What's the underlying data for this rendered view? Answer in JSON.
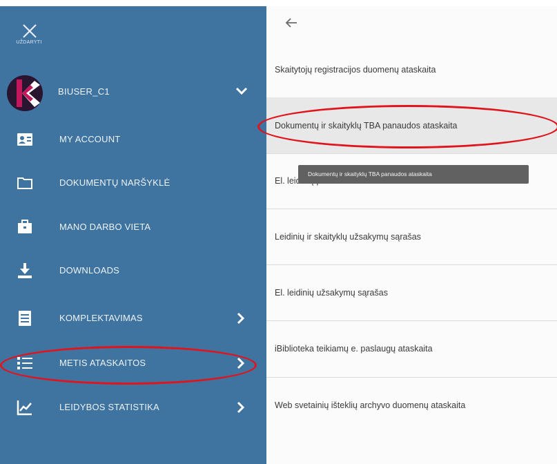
{
  "sidebar": {
    "close_caption": "UŽDARYTI",
    "user": {
      "name": "BIUSER_C1"
    },
    "items": [
      {
        "label": "MY ACCOUNT",
        "icon": "account-card-icon"
      },
      {
        "label": "DOKUMENTŲ NARŠYKLĖ",
        "icon": "folder-icon"
      },
      {
        "label": "MANO DARBO VIETA",
        "icon": "briefcase-icon"
      },
      {
        "label": "DOWNLOADS",
        "icon": "download-icon"
      },
      {
        "label": "KOMPLEKTAVIMAS",
        "icon": "document-icon"
      },
      {
        "label": "METIS ATASKAITOS",
        "icon": "list-icon"
      },
      {
        "label": "LEIDYBOS STATISTIKA",
        "icon": "chart-icon"
      }
    ]
  },
  "panel": {
    "reports": [
      "Skaitytojų registracijos duomenų ataskaita",
      "Dokumentų ir skaityklų TBA panaudos ataskaita",
      "El. leidinių panaudos ataskaita",
      "Leidinių ir skaityklų užsakymų sąrašas",
      "El. leidinių užsakymų sąrašas",
      "iBiblioteka teikiamų e. paslaugų ataskaita",
      "Web svetainių išteklių archyvo duomenų ataskaita"
    ],
    "tooltip": "Dokumentų ir skaityklų TBA panaudos ataskaita"
  },
  "colors": {
    "sidebar_bg": "#3f73a0",
    "highlight_ring": "#e0141c",
    "tooltip_bg": "#616161"
  }
}
